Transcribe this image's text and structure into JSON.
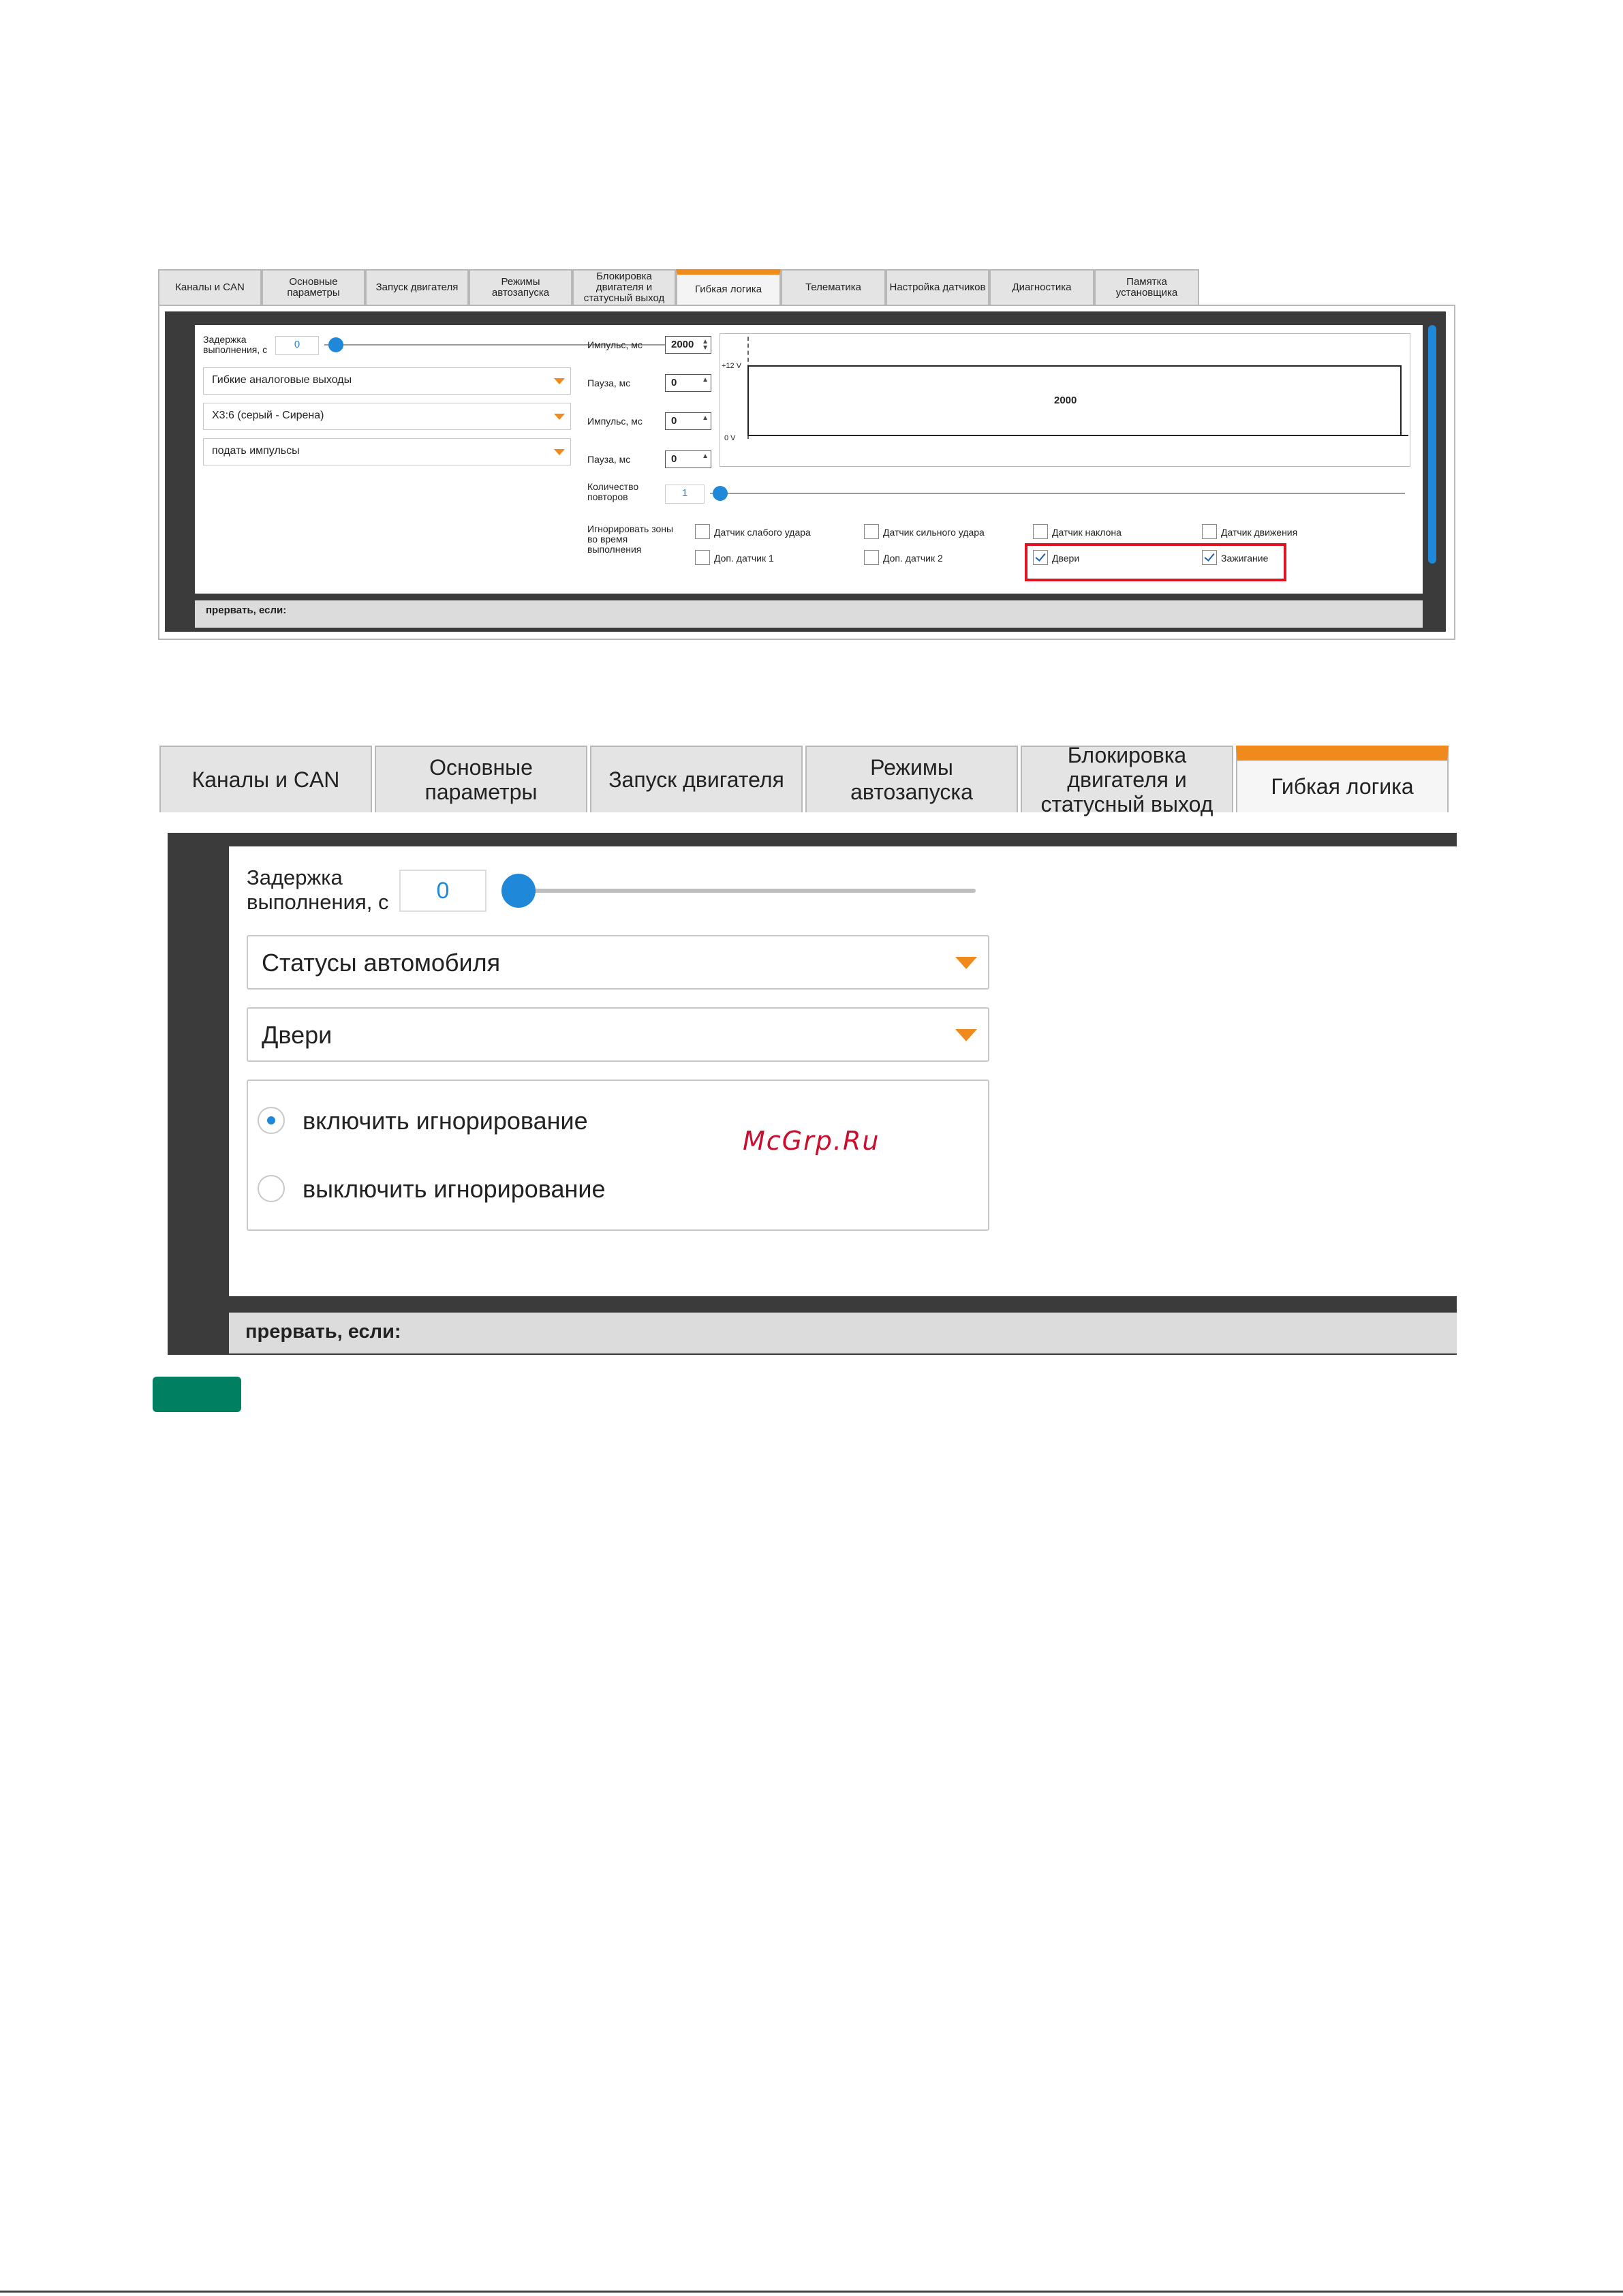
{
  "top_screenshot": {
    "tabs": [
      "Каналы и CAN",
      "Основные\nпараметры",
      "Запуск двигателя",
      "Режимы\nавтозапуска",
      "Блокировка\nдвигателя и\nстатусный выход",
      "Гибкая логика",
      "Телематика",
      "Настройка датчиков",
      "Диагностика",
      "Памятка\nустановщика"
    ],
    "active_tab": "Гибкая логика",
    "delay_label": "Задержка\nвыполнения, с",
    "delay_value": "0",
    "select_output_type": "Гибкие аналоговые выходы",
    "select_output": "Х3:6 (серый - Сирена)",
    "select_action": "подать импульсы",
    "impulse_label_1": "Импульс, мс",
    "impulse_value_1": "2000",
    "pause_label_1": "Пауза, мс",
    "pause_value_1": "0",
    "impulse_label_2": "Импульс, мс",
    "impulse_value_2": "0",
    "pause_label_2": "Пауза, мс",
    "pause_value_2": "0",
    "graph_top_label": "+12 V",
    "graph_bottom_label": "0 V",
    "graph_pulse_label": "2000",
    "repeat_label": "Количество\nповторов",
    "repeat_value": "1",
    "ignore_label": "Игнорировать зоны\nво время\nвыполнения",
    "checkboxes": [
      {
        "label": "Датчик слабого удара",
        "checked": false
      },
      {
        "label": "Датчик сильного удара",
        "checked": false
      },
      {
        "label": "Датчик наклона",
        "checked": false
      },
      {
        "label": "Датчик движения",
        "checked": false
      },
      {
        "label": "Доп. датчик 1",
        "checked": false
      },
      {
        "label": "Доп. датчик 2",
        "checked": false
      },
      {
        "label": "Двери",
        "checked": true
      },
      {
        "label": "Зажигание",
        "checked": true
      }
    ],
    "abort_label": "прервать, если:",
    "highlight_color": "#e0141e"
  },
  "bottom_screenshot": {
    "tabs": [
      "Каналы и CAN",
      "Основные\nпараметры",
      "Запуск двигателя",
      "Режимы\nавтозапуска",
      "Блокировка\nдвигателя и\nстатусный выход",
      "Гибкая логика"
    ],
    "active_tab": "Гибкая логика",
    "delay_label": "Задержка\nвыполнения, с",
    "delay_value": "0",
    "select_category": "Статусы автомобиля",
    "select_item": "Двери",
    "radio_on": "включить игнорирование",
    "radio_off": "выключить игнорирование",
    "abort_label": "прервать, если:"
  },
  "watermark": "McGrp.Ru",
  "colors": {
    "accent": "#1f88d8",
    "tab_active": "#f08a1c",
    "badge": "#008060"
  }
}
